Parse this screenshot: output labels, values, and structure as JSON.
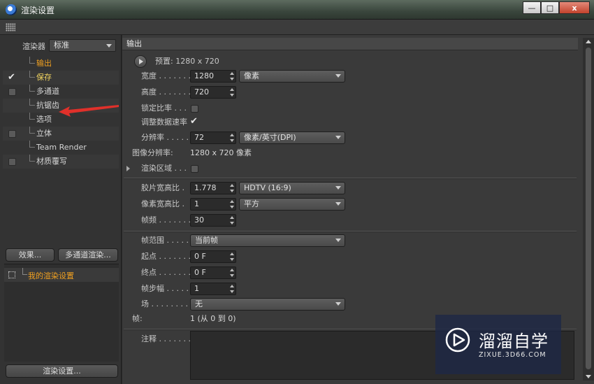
{
  "window": {
    "title": "渲染设置",
    "minimize": "—",
    "maximize": "□",
    "close": "x"
  },
  "left": {
    "renderer_label": "渲染器",
    "renderer_value": "标准",
    "tree": [
      {
        "label": "输出",
        "checkbox": false,
        "checked": false,
        "color": "orange"
      },
      {
        "label": "保存",
        "checkbox": true,
        "checked": true,
        "color": "yellow"
      },
      {
        "label": "多通道",
        "checkbox": true,
        "checked": false,
        "color": "normal"
      },
      {
        "label": "抗锯齿",
        "checkbox": false,
        "checked": false,
        "color": "normal"
      },
      {
        "label": "选项",
        "checkbox": false,
        "checked": false,
        "color": "normal"
      },
      {
        "label": "立体",
        "checkbox": true,
        "checked": false,
        "color": "normal"
      },
      {
        "label": "Team Render",
        "checkbox": false,
        "checked": false,
        "color": "normal"
      },
      {
        "label": "材质覆写",
        "checkbox": true,
        "checked": false,
        "color": "normal"
      }
    ],
    "effects_button": "效果...",
    "multipass_button": "多通道渲染...",
    "preset_label": "我的渲染设置",
    "render_settings_button": "渲染设置..."
  },
  "output": {
    "header": "输出",
    "preset": "预置: 1280 x 720",
    "width_label": "宽度 . . . . . . . . .",
    "width_value": "1280",
    "width_unit": "像素",
    "height_label": "高度 . . . . . . . . .",
    "height_value": "720",
    "lock_ratio_label": "锁定比率 . . .",
    "adjust_data_rate_label": "调整数据速率",
    "resolution_label": "分辨率 . . . . . .",
    "resolution_value": "72",
    "resolution_unit": "像素/英寸(DPI)",
    "image_resolution_label": "图像分辨率:",
    "image_resolution_value": "1280 x 720 像素",
    "render_region_label": "渲染区域 . . .",
    "film_aspect_label": "胶片宽高比 .",
    "film_aspect_value": "1.778",
    "film_aspect_preset": "HDTV (16:9)",
    "pixel_aspect_label": "像素宽高比 .",
    "pixel_aspect_value": "1",
    "pixel_aspect_preset": "平方",
    "frame_rate_label": "帧频 . . . . . . . . .",
    "frame_rate_value": "30",
    "frame_range_label": "帧范围 . . . . . .",
    "frame_range_value": "当前帧",
    "start_label": "起点 . . . . . . . . .",
    "start_value": "0 F",
    "end_label": "终点 . . . . . . . . .",
    "end_value": "0 F",
    "frame_step_label": "帧步幅 . . . . . .",
    "frame_step_value": "1",
    "field_label": "场 . . . . . . . . . . .",
    "field_value": "无",
    "frames_label": "帧:",
    "frames_value": "1 (从 0 到 0)",
    "notes_label": "注释 . . . . . . . ."
  },
  "watermark": {
    "title": "溜溜自学",
    "subtitle": "ZIXUE.3D66.COM"
  },
  "colors": {
    "accent_orange": "#f0a020",
    "annotation_red": "#e0302a"
  }
}
